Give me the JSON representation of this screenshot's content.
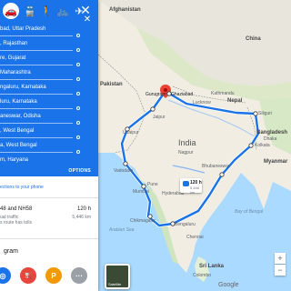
{
  "modes": {
    "car": "🚗",
    "transit": "🚆",
    "walk": "🚶",
    "bike": "🚲",
    "flight": "✈"
  },
  "close_symbol": "✕",
  "stops": [
    {
      "label": "bad, Uttar Pradesh"
    },
    {
      "label": ", Rajasthan"
    },
    {
      "label": "re, Gujarat"
    },
    {
      "label": "Maharashtra"
    },
    {
      "label": "ngaluru, Karnataka"
    },
    {
      "label": "luru, Karnataka"
    },
    {
      "label": "aneswar, Odisha"
    },
    {
      "label": ", West Bengal"
    },
    {
      "label": "a, West Bengal"
    },
    {
      "label": "m, Haryana"
    }
  ],
  "options_label": "OPTIONS",
  "send_phone": "ections to your phone",
  "route": {
    "title": "48 and NH58",
    "time": "120 h",
    "traffic": "ual traffic",
    "distance": "5,446 km",
    "tolls": "s route has tolls"
  },
  "explore_title": "gram",
  "explore": [
    {
      "symbol": "◎",
      "color": "#1a73e8"
    },
    {
      "symbol": "⛽",
      "color": "#e8453c"
    },
    {
      "symbol": "P",
      "color": "#f29900"
    },
    {
      "symbol": "···",
      "color": "#9aa0a6"
    }
  ],
  "map": {
    "countries": {
      "pakistan": "Pakistan",
      "india": "India",
      "nepal": "Nepal",
      "bangladesh": "Bangladesh",
      "myanmar": "Myanmar",
      "sri_lanka": "Sri Lanka",
      "afghanistan": "Afghanistan",
      "china": "China"
    },
    "water": {
      "bay": "Bay of Bengal",
      "arabian": "Arabian Sea"
    },
    "cities": {
      "gurugram": "Gurugram",
      "ghaziabad": "Ghaziabad",
      "jaipur": "Jaipur",
      "udaipur": "Udaipur",
      "vadodara": "Vadodara",
      "pune": "Pune",
      "mumbai": "Mumbai",
      "hyderabad": "Hyderabad",
      "chikmagalur": "Chikmagalur",
      "bengaluru": "Bengaluru",
      "chennai": "Chennai",
      "kolkata": "Kolkata",
      "bhubaneswar": "Bhubaneswar",
      "siliguri": "Siliguri",
      "lucknow": "Lucknow",
      "kathmandu": "Kathmandu",
      "dhaka": "Dhaka",
      "nagpur": "Nagpur",
      "colombo": "Colombo"
    },
    "time_box": {
      "time": "120 h",
      "dist": "5,446 km"
    },
    "satellite_label": "Satellite",
    "google": "Google"
  }
}
